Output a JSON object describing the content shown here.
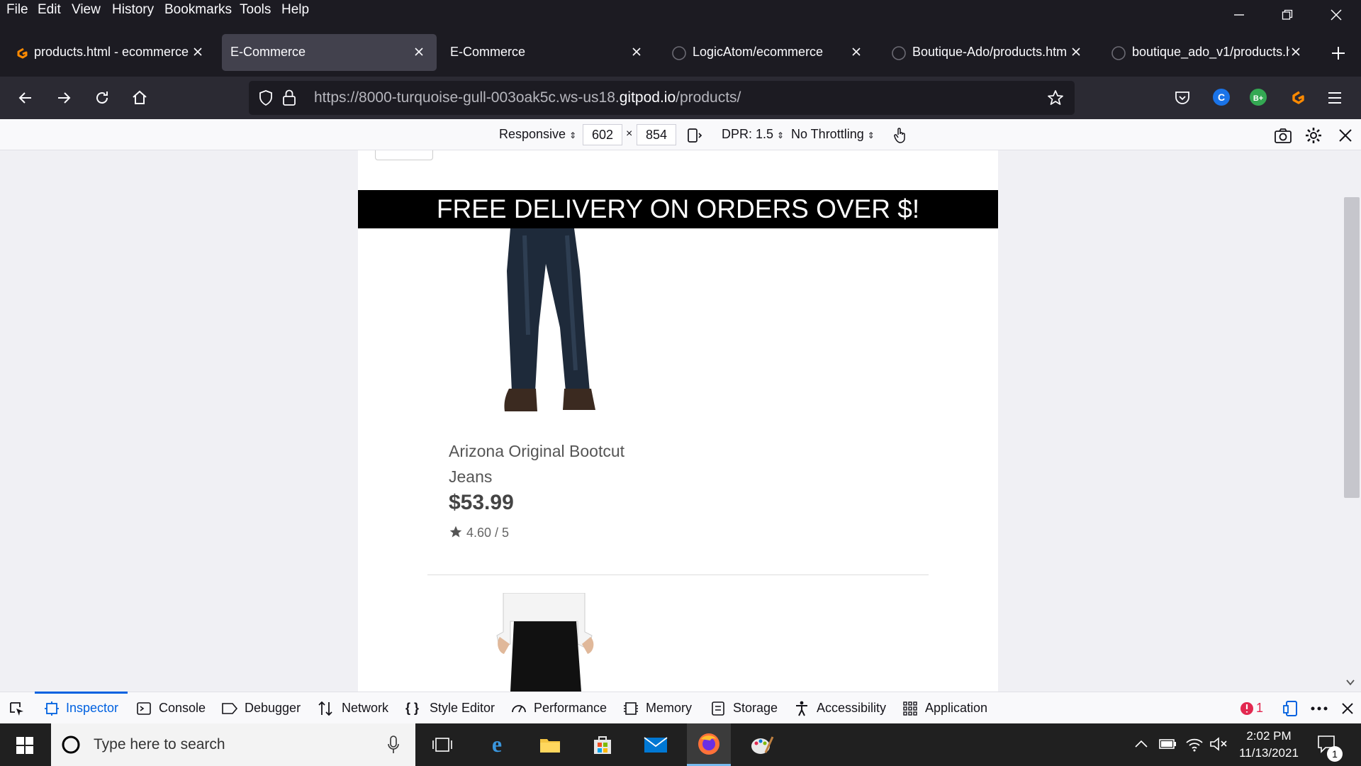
{
  "menu": [
    "File",
    "Edit",
    "View",
    "History",
    "Bookmarks",
    "Tools",
    "Help"
  ],
  "tabs": [
    {
      "title": "products.html - ecommerce",
      "icon": "gitpod-icon"
    },
    {
      "title": "E-Commerce",
      "icon": "none"
    },
    {
      "title": "E-Commerce",
      "icon": "none"
    },
    {
      "title": "LogicAtom/ecommerce",
      "icon": "github-icon"
    },
    {
      "title": "Boutique-Ado/products.htm",
      "icon": "github-icon"
    },
    {
      "title": "boutique_ado_v1/products.h",
      "icon": "github-icon"
    }
  ],
  "url": {
    "prefix": "https://8000-turquoise-gull-003oak5c.ws-us18.",
    "domain": "gitpod.io",
    "suffix": "/products/"
  },
  "rdm": {
    "mode": "Responsive",
    "width": "602",
    "times": "×",
    "height": "854",
    "dpr": "DPR: 1.5",
    "throttle": "No Throttling"
  },
  "page": {
    "banner": "FREE DELIVERY ON ORDERS OVER $!",
    "product": {
      "name": "Arizona Original Bootcut Jeans",
      "price": "$53.99",
      "rating": "4.60 / 5"
    }
  },
  "devtools": {
    "tabs": [
      "Inspector",
      "Console",
      "Debugger",
      "Network",
      "Style Editor",
      "Performance",
      "Memory",
      "Storage",
      "Accessibility",
      "Application"
    ],
    "errors": "1"
  },
  "taskbar": {
    "search_placeholder": "Type here to search",
    "time": "2:02 PM",
    "date": "11/13/2021",
    "notif_count": "1"
  }
}
